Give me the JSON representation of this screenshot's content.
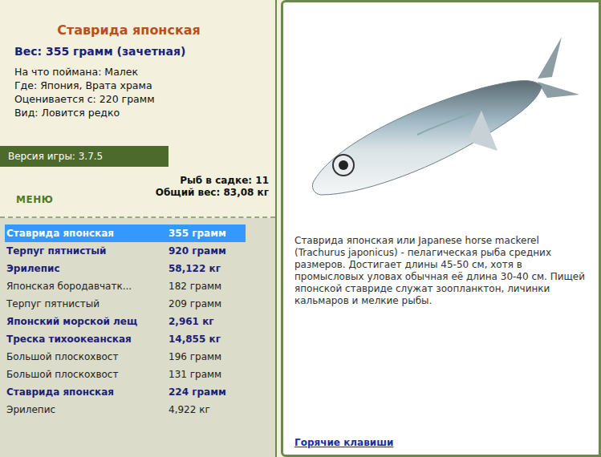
{
  "fish": {
    "title": "Ставрида японская",
    "weight": "Вес: 355 грамм (зачетная)",
    "details": [
      "На что поймана: Малек",
      "Где: Япония, Врата храма",
      "Оценивается с: 220 грамм",
      "Вид: Ловится редко"
    ]
  },
  "version": "Версия игры: 3.7.5",
  "menu": "МЕНЮ",
  "stats": [
    "Рыб в садке: 11",
    "Общий вес: 83,08 кг"
  ],
  "catch": [
    {
      "name": "Ставрида японская",
      "weight": "355 грамм",
      "trophy": true,
      "selected": true
    },
    {
      "name": "Терпуг пятнистый",
      "weight": "920 грамм",
      "trophy": true,
      "selected": false
    },
    {
      "name": "Эрилепис",
      "weight": "58,122 кг",
      "trophy": true,
      "selected": false
    },
    {
      "name": "Японская бородавчатк...",
      "weight": "182 грамм",
      "trophy": false,
      "selected": false
    },
    {
      "name": "Терпуг пятнистый",
      "weight": "209 грамм",
      "trophy": false,
      "selected": false
    },
    {
      "name": "Японский морской лещ",
      "weight": "2,961 кг",
      "trophy": true,
      "selected": false
    },
    {
      "name": "Треска тихоокеанская",
      "weight": "14,855 кг",
      "trophy": true,
      "selected": false
    },
    {
      "name": "Большой плоскохвост",
      "weight": "196 грамм",
      "trophy": false,
      "selected": false
    },
    {
      "name": "Большой плоскохвост",
      "weight": "131 грамм",
      "trophy": false,
      "selected": false
    },
    {
      "name": "Ставрида японская",
      "weight": "224 грамм",
      "trophy": true,
      "selected": false
    },
    {
      "name": "Эрилепис",
      "weight": "4,922 кг",
      "trophy": false,
      "selected": false
    }
  ],
  "description": "Ставрида японская или Japanese horse mackerel (Trachurus japonicus) - пелагическая рыба средних размеров. Достигает длины 45-50 см, хотя в промысловых уловах обычная её длина 30-40 см. Пищей японской ставриде служат зоопланктон, личинки кальмаров и мелкие рыбы.",
  "hotkeys": "Горячие клавиши"
}
